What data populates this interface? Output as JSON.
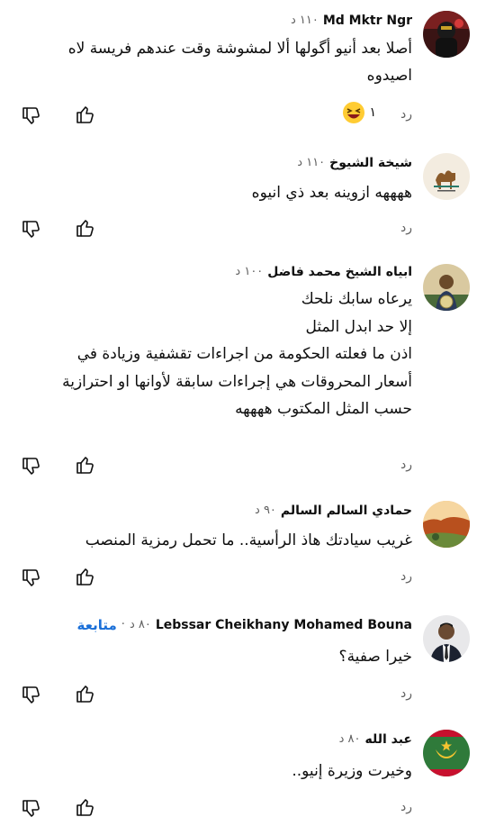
{
  "ui": {
    "reply_label": "رد"
  },
  "comments": [
    {
      "author": "Md Mktr Ngr",
      "time": "١١٠ د",
      "lines": [
        "أصلا بعد أنيو أگولها ألا لمشوشة وقت عندهم فريسة لاه",
        "اصيدوه"
      ],
      "reaction": {
        "icon": "laughing-emoji-icon",
        "count": "١"
      }
    },
    {
      "author": "شيخة الشيوخ",
      "time": "١١٠ د",
      "lines": [
        "ههههه ازوينه بعد ذي انيوه"
      ]
    },
    {
      "author": "ابياه الشيخ محمد فاضل",
      "time": "١٠٠ د",
      "lines": [
        "يرعاه سابك نلحك",
        "إلا حد ابدل المثل",
        "اذن ما فعلته الحكومة من اجراءات تقشفية وزيادة  في",
        "أسعار المحروقات هي إجراءات سابقة لأوانها  او احترازية",
        "حسب المثل المكتوب ههههه"
      ]
    },
    {
      "author": "حمادي السالم السالم",
      "time": "٩٠ د",
      "lines": [
        "غريب سيادتك هاذ الرأسية.. ما تحمل رمزية المنصب"
      ]
    },
    {
      "author": "Lebssar Cheikhany Mohamed Bouna",
      "time": "٨٠ د",
      "follow": "متابعة",
      "lines": [
        "خيرا صفية؟"
      ]
    },
    {
      "author": "عبد الله",
      "time": "٨٠ د",
      "lines": [
        "وخيرت وزيرة إنيو.."
      ]
    }
  ]
}
